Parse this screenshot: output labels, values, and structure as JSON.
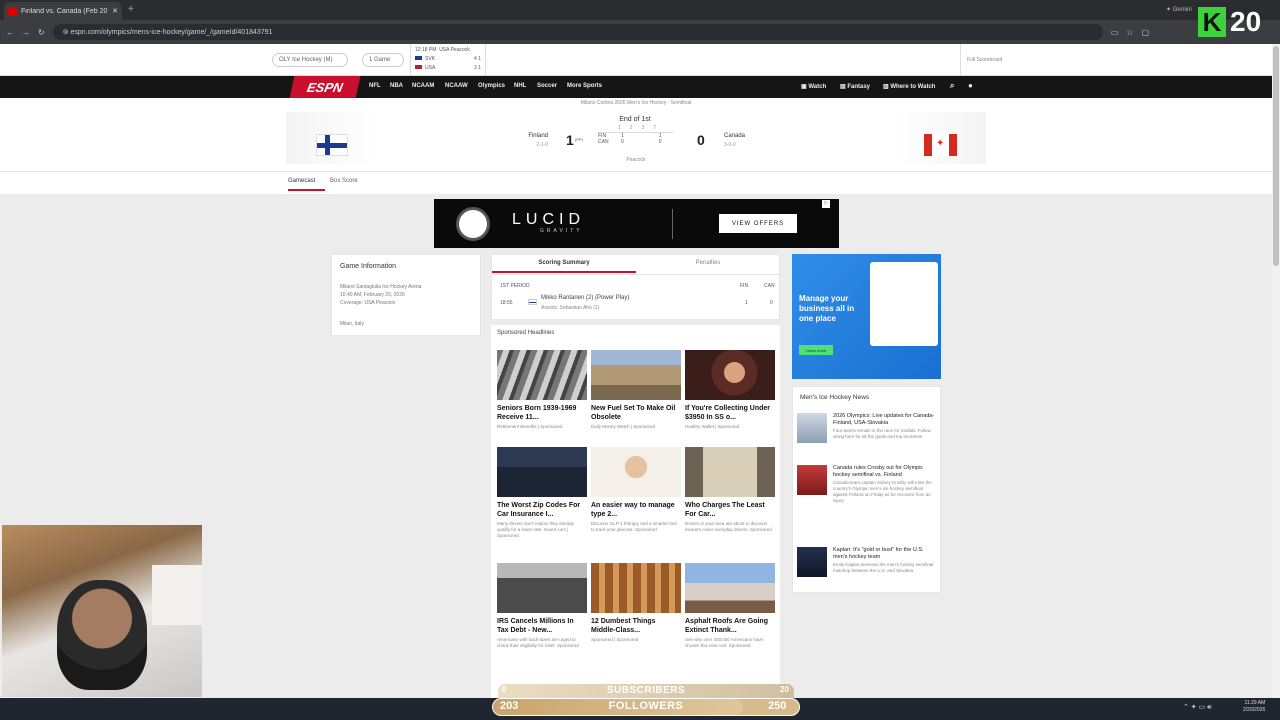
{
  "browser": {
    "tab_title": "Finland vs. Canada (Feb 20, 20",
    "new_tab": "+",
    "url": "espn.com/olympics/mens-ice-hockey/game/_/gameId/401843791",
    "profile_label": "Gemini"
  },
  "overlay_badge": {
    "letter": "K",
    "number": "20"
  },
  "subnav": {
    "pill1": "OLY Ice Hockey (M)",
    "pill2": "1 Game",
    "mini_time": "12:18 PM",
    "mini_network": "USA Peacock",
    "mini_team1": "SVK",
    "mini_score1": "4 1",
    "mini_team2": "USA",
    "mini_score2": "3 1",
    "right_text": "Full Scoreboard"
  },
  "espn_nav": {
    "logo": "ESPN",
    "links": [
      "NFL",
      "NBA",
      "NCAAM",
      "NCAAW",
      "Olympics",
      "NHL",
      "Soccer",
      "More Sports"
    ],
    "right": [
      "Watch",
      "Fantasy",
      "Where to Watch"
    ]
  },
  "game_header": "Milano Cortina 2026 Men's Ice Hockey - Semifinal",
  "score": {
    "status": "End of 1st",
    "away_team": "Finland",
    "away_record": "2-1-0",
    "away_score": "1",
    "away_score_suffix": "(PP)",
    "home_team": "Canada",
    "home_record": "3-0-0",
    "home_score": "0",
    "periods": [
      "1",
      "2",
      "3",
      "T"
    ],
    "away_abbr": "FIN",
    "home_abbr": "CAN",
    "away_line": [
      "1",
      "",
      "",
      "1"
    ],
    "home_line": [
      "0",
      "",
      "",
      "0"
    ],
    "broadcast": "Peacock"
  },
  "page_tabs": [
    "Gamecast",
    "Box Score"
  ],
  "ad_banner": {
    "brand": "LUCID",
    "sub": "GRAVITY",
    "cta": "VIEW OFFERS"
  },
  "game_info": {
    "title": "Game Information",
    "venue": "Milano Santagiulia Ice Hockey Arena",
    "datetime": "10:40 AM, February 20, 2026",
    "coverage": "Coverage: USA Peacock",
    "location": "Milan, Italy"
  },
  "scoring": {
    "tab1": "Scoring Summary",
    "tab2": "Penalties",
    "period": "1ST PERIOD",
    "col1": "FIN",
    "col2": "CAN",
    "time": "18:55",
    "scorer": "Mikko Rantanen (2) (Power Play)",
    "assists": "Assists: Sebastian Aho (1)",
    "fin_score": "1",
    "can_score": "0"
  },
  "sponsored": {
    "title": "Sponsored Headlines",
    "items": [
      {
        "h": "Seniors Born 1939-1969 Receive 11...",
        "s": "Retirement Benefits | Sponsored"
      },
      {
        "h": "New Fuel Set To Make Oil Obsolete",
        "s": "Daily Money Watch | Sponsored"
      },
      {
        "h": "If You're Collecting Under $3950 In SS o...",
        "s": "Healthy Wallet | Sponsored"
      },
      {
        "h": "The Worst Zip Codes For Car Insurance I...",
        "s": "Many drivers don't realize they already qualify for a lower rate. Insure.com | Sponsored"
      },
      {
        "h": "An easier way to manage type 2...",
        "s": "Discover GLP-1 therapy and a smarter tool to track your glucose. Sponsored"
      },
      {
        "h": "Who Charges The Least For Car...",
        "s": "Drivers in your area are about to discover insurers cover everyday drivers. Sponsored"
      },
      {
        "h": "IRS Cancels Millions In Tax Debt - New...",
        "s": "Americans with back taxes are urged to check their eligibility for relief. Sponsored"
      },
      {
        "h": "12 Dumbest Things Middle-Class...",
        "s": "Sponsored | Sponsored"
      },
      {
        "h": "Asphalt Roofs Are Going Extinct Thank...",
        "s": "See why over 400,000 Americans have chosen this new roof. Sponsored"
      }
    ]
  },
  "side_ad": {
    "headline": "Manage your business all in one place",
    "cta": "Learn more"
  },
  "news": {
    "title": "Men's Ice Hockey News",
    "items": [
      {
        "h": "2026 Olympics: Live updates for Canada-Finland, USA-Slovakia",
        "s": "Four teams remain in the race for medals. Follow along here for all the goals and top moments."
      },
      {
        "h": "Canada rules Crosby out for Olympic hockey semifinal vs. Finland",
        "s": "Canada team captain Sidney Crosby will miss the country's Olympic men's ice hockey semifinal against Finland on Friday as he recovers from an injury."
      },
      {
        "h": "Kaplan: It's \"gold or bust\" for the U.S. men's hockey team",
        "s": "Emily Kaplan previews the men's hockey semifinal matchup between the U.S. and Slovakia."
      }
    ]
  },
  "stream_overlay": {
    "subscribers_label": "SUBSCRIBERS",
    "subscribers_left": "0",
    "subscribers_right": "20",
    "followers_label": "FOLLOWERS",
    "followers_left": "203",
    "followers_right": "250"
  },
  "taskbar": {
    "time": "11:29 AM",
    "date": "2/20/2026"
  }
}
